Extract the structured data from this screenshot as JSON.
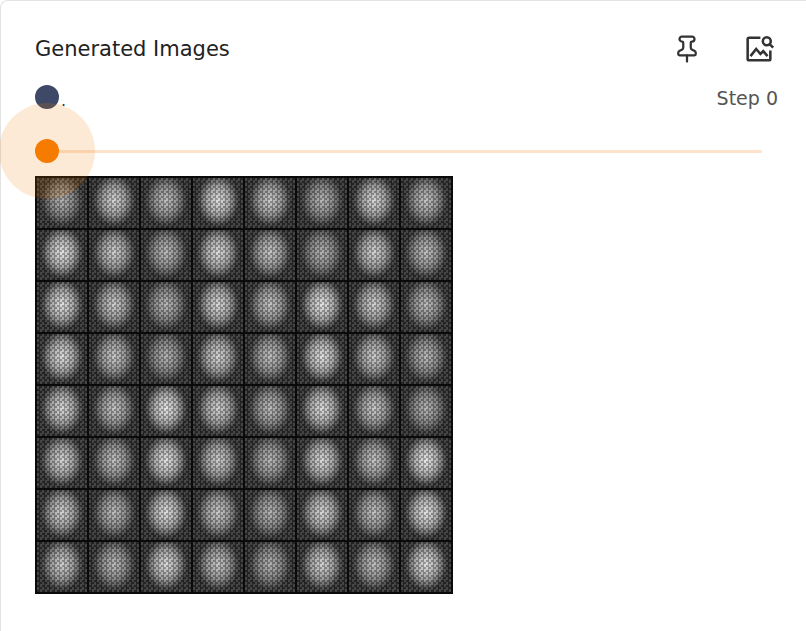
{
  "card": {
    "title": "Generated Images"
  },
  "run": {
    "label": ".",
    "color": "#3d4966"
  },
  "step": {
    "label": "Step 0"
  },
  "slider": {
    "level": 0,
    "focused": true
  }
}
